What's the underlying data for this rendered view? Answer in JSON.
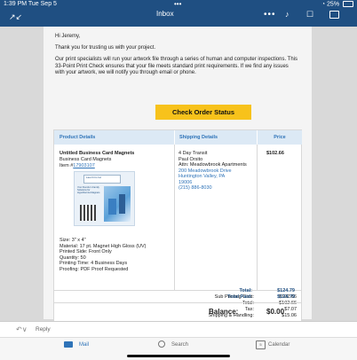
{
  "status": {
    "time": "1:39 PM  Tue Sep 5",
    "dots": "•••",
    "battery": "25%"
  },
  "header": {
    "title": "Inbox",
    "more": "•••"
  },
  "email": {
    "greeting": "Hi Jeremy,",
    "thanks": "Thank you for trusting us with your project.",
    "intro": "Our print specialists will run your artwork file through a series of human and computer inspections. This 33-Point Print Check ensures that your file meets standard print requirements. If we find any issues with your artwork, we will notify you through email or phone.",
    "cta": "Check Order Status",
    "table": {
      "headers": [
        "Product Details",
        "Shipping Details",
        "Price"
      ],
      "product": {
        "name": "Untitled Business Card Magnets",
        "subtitle": "Business Card Magnets",
        "item_prefix": "Item #",
        "item_number": "17903107",
        "thumb_logo": "Law Firm Inc",
        "thumb_text": "Your friends in Family Solutions for Hypothermia Magnets",
        "specs": [
          "Size: 3\" x 4\"",
          "Material: 17 pt. Magnet High Gloss (UV)",
          "Printed Side: Front Only",
          "Quantity: 50",
          "Printing Time: 4 Business Days",
          "Proofing: PDF Proof Requested"
        ]
      },
      "shipping": {
        "method": "4 Day Transit",
        "name": "Paul Orsito",
        "attn": "Attn: Meadowbrook Apartments",
        "street": "200 Meadowbrook Drive",
        "city": "Huntington Valley, PA",
        "zip": "19006",
        "phone": "(215) 886-8030"
      },
      "price": "$102.66"
    },
    "totals": [
      {
        "label": "Sub Printing Cost:",
        "value": "$102.66"
      },
      {
        "label": "Total:",
        "value": "$102.66"
      },
      {
        "label": "Tax:",
        "value": "$7.07"
      },
      {
        "label": "Shipping & Handling:",
        "value": "$15.06"
      }
    ],
    "grand": [
      {
        "label": "Total:",
        "value": "$124.79"
      },
      {
        "label": "Total Paid:",
        "value": "$124.79"
      }
    ],
    "balance": {
      "label": "Balance:",
      "value": "$0.00"
    }
  },
  "reply": {
    "label": "Reply"
  },
  "tabs": [
    {
      "label": "Mail"
    },
    {
      "label": "Search"
    },
    {
      "label": "Calendar"
    }
  ]
}
